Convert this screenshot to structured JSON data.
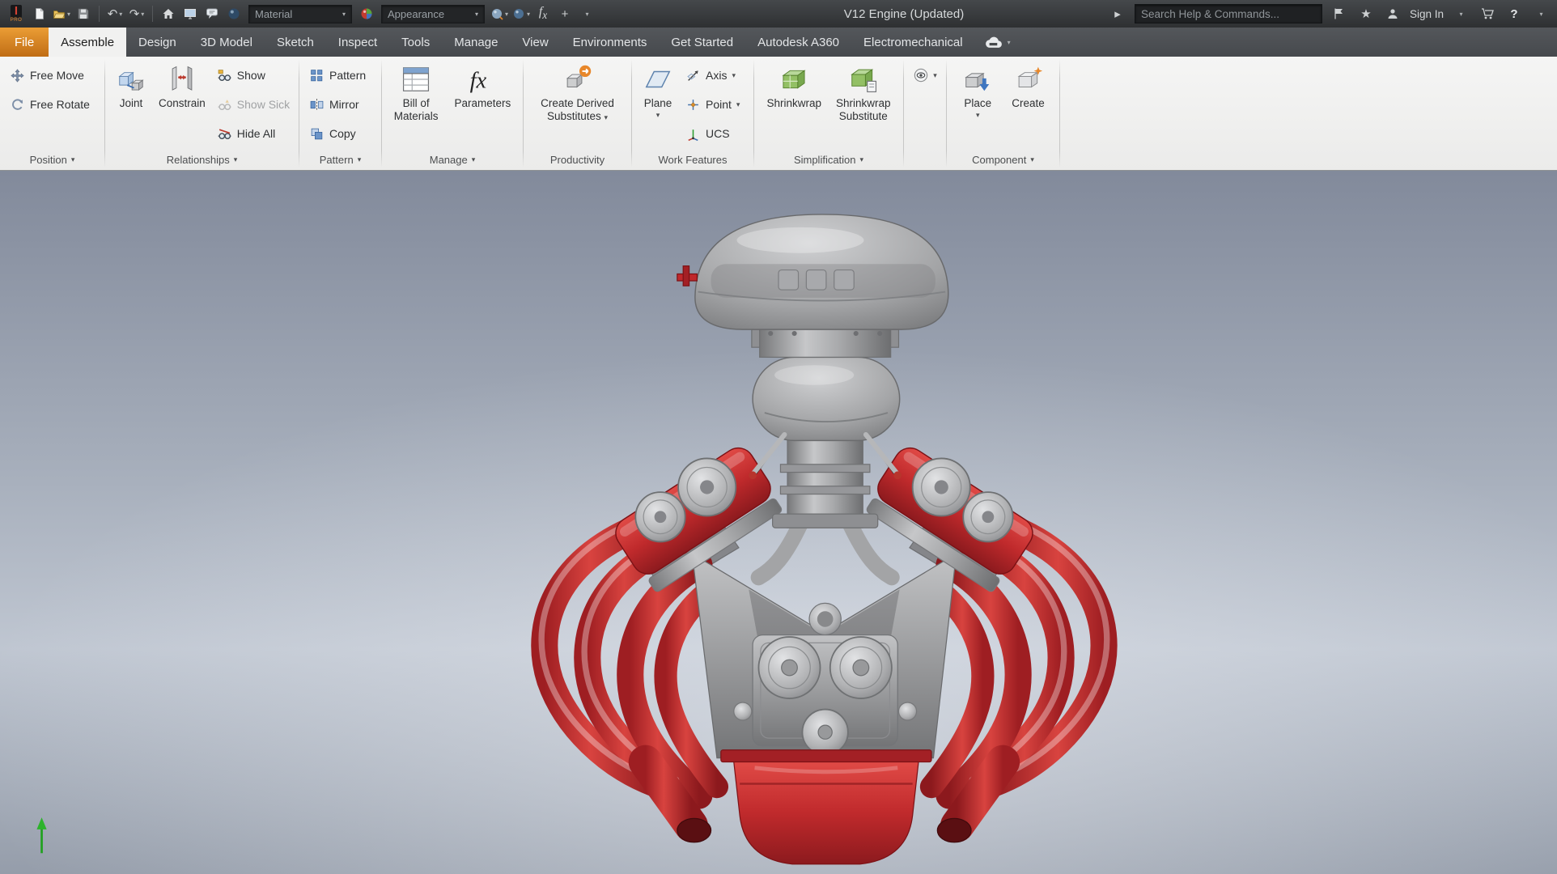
{
  "colors": {
    "file_tab_orange": "#d8821f",
    "accent_blue": "#3f76c0",
    "simplify_green": "#93c065",
    "metal_gray": "#9b9c9e",
    "engine_red": "#c0282c",
    "engine_red_dark": "#a32025",
    "viewport_top": "#828a9b",
    "viewport_bottom": "#959daa"
  },
  "titlebar": {
    "logo_sub": "PRO",
    "material_label": "Material",
    "appearance_label": "Appearance",
    "document_title": "V12 Engine (Updated)",
    "search_placeholder": "Search Help & Commands...",
    "sign_in_label": "Sign In"
  },
  "tabs": {
    "file": "File",
    "assemble": "Assemble",
    "design": "Design",
    "model3d": "3D Model",
    "sketch": "Sketch",
    "inspect": "Inspect",
    "tools": "Tools",
    "manage": "Manage",
    "view": "View",
    "environments": "Environments",
    "get_started": "Get Started",
    "a360": "Autodesk A360",
    "electromechanical": "Electromechanical"
  },
  "ribbon": {
    "position": {
      "label": "Position",
      "free_move": "Free Move",
      "free_rotate": "Free Rotate"
    },
    "relationships": {
      "label": "Relationships",
      "joint": "Joint",
      "constrain": "Constrain",
      "show": "Show",
      "show_sick": "Show Sick",
      "hide_all": "Hide All"
    },
    "pattern": {
      "label": "Pattern",
      "pattern": "Pattern",
      "mirror": "Mirror",
      "copy": "Copy"
    },
    "manage": {
      "label": "Manage",
      "bom_line1": "Bill of",
      "bom_line2": "Materials",
      "parameters": "Parameters"
    },
    "productivity": {
      "label": "Productivity",
      "derived_line1": "Create Derived",
      "derived_line2": "Substitutes"
    },
    "work_features": {
      "label": "Work Features",
      "plane": "Plane",
      "axis": "Axis",
      "point": "Point",
      "ucs": "UCS"
    },
    "simplification": {
      "label": "Simplification",
      "shrinkwrap": "Shrinkwrap",
      "sub_line1": "Shrinkwrap",
      "sub_line2": "Substitute"
    },
    "component": {
      "label": "Component",
      "place": "Place",
      "create": "Create"
    }
  }
}
